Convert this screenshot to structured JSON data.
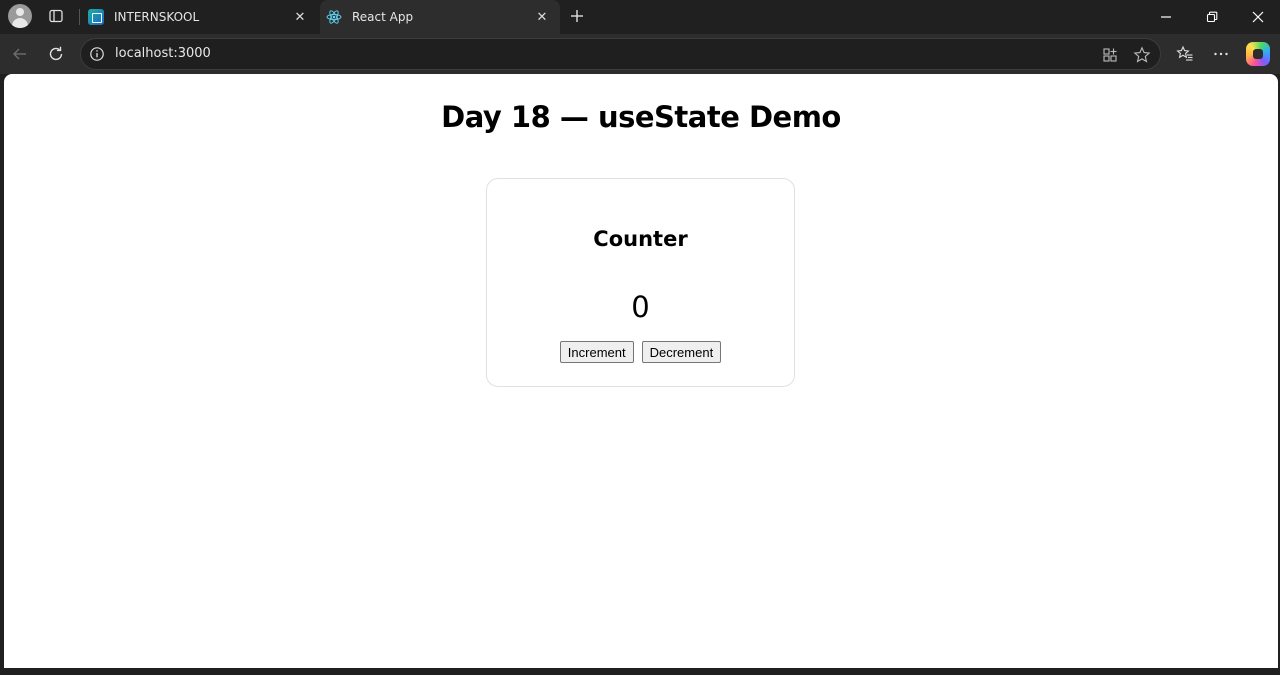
{
  "browser": {
    "tabs": [
      {
        "title": "INTERNSKOOL",
        "active": false,
        "favicon": "internskool-favicon"
      },
      {
        "title": "React App",
        "active": true,
        "favicon": "react-favicon"
      }
    ],
    "address": "localhost:3000"
  },
  "page": {
    "title": "Day 18 — useState Demo",
    "counter": {
      "heading": "Counter",
      "value": "0",
      "increment_label": "Increment",
      "decrement_label": "Decrement"
    }
  },
  "colors": {
    "chrome_dark": "#202020",
    "toolbar": "#2d2d2d",
    "page_bg": "#ffffff"
  }
}
